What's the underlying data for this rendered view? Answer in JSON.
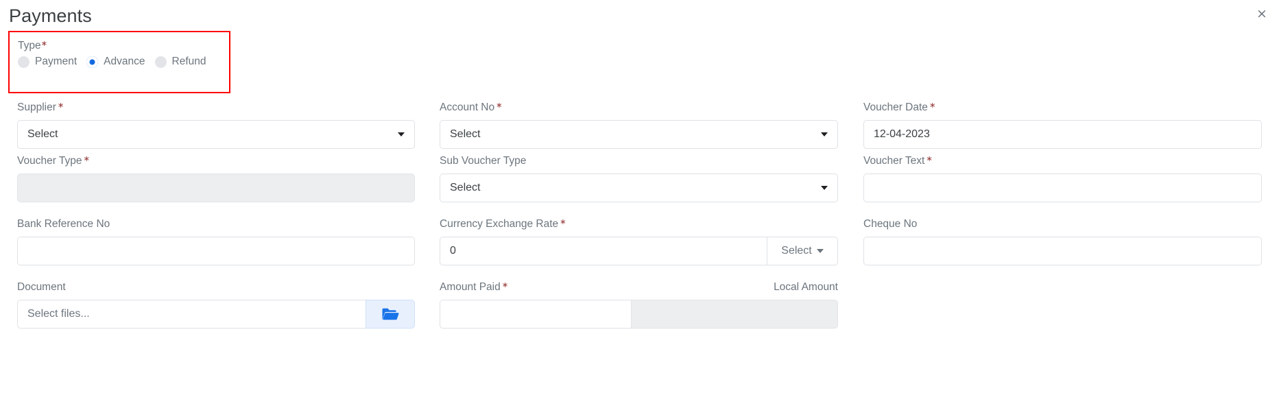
{
  "header": {
    "title": "Payments",
    "close_label": "×"
  },
  "type_group": {
    "label": "Type",
    "required_mark": "*",
    "options": [
      {
        "label": "Payment",
        "selected": false
      },
      {
        "label": "Advance",
        "selected": true
      },
      {
        "label": "Refund",
        "selected": false
      }
    ],
    "highlight_color": "#ff0000",
    "selected_color": "#1269e0"
  },
  "fields": {
    "supplier": {
      "label": "Supplier",
      "required_mark": "*",
      "value": "Select"
    },
    "account_no": {
      "label": "Account No",
      "required_mark": "*",
      "value": "Select"
    },
    "voucher_date": {
      "label": "Voucher Date",
      "required_mark": "*",
      "value": "12-04-2023"
    },
    "voucher_type": {
      "label": "Voucher Type",
      "required_mark": "*",
      "value": ""
    },
    "sub_voucher_type": {
      "label": "Sub Voucher Type",
      "required_mark": "",
      "value": "Select"
    },
    "voucher_text": {
      "label": "Voucher Text",
      "required_mark": "*",
      "value": ""
    },
    "bank_reference_no": {
      "label": "Bank Reference No",
      "required_mark": "",
      "value": ""
    },
    "currency_exchange_rate": {
      "label": "Currency Exchange Rate",
      "required_mark": "*",
      "value": "0",
      "currency_label": "Select"
    },
    "cheque_no": {
      "label": "Cheque No",
      "required_mark": "",
      "value": ""
    },
    "document": {
      "label": "Document",
      "required_mark": "",
      "placeholder": "Select files...",
      "browse_icon": "folder-open-icon"
    },
    "amount_paid": {
      "label": "Amount Paid",
      "required_mark": "*",
      "value": "",
      "local_amount_label": "Local Amount",
      "local_amount_value": ""
    }
  }
}
